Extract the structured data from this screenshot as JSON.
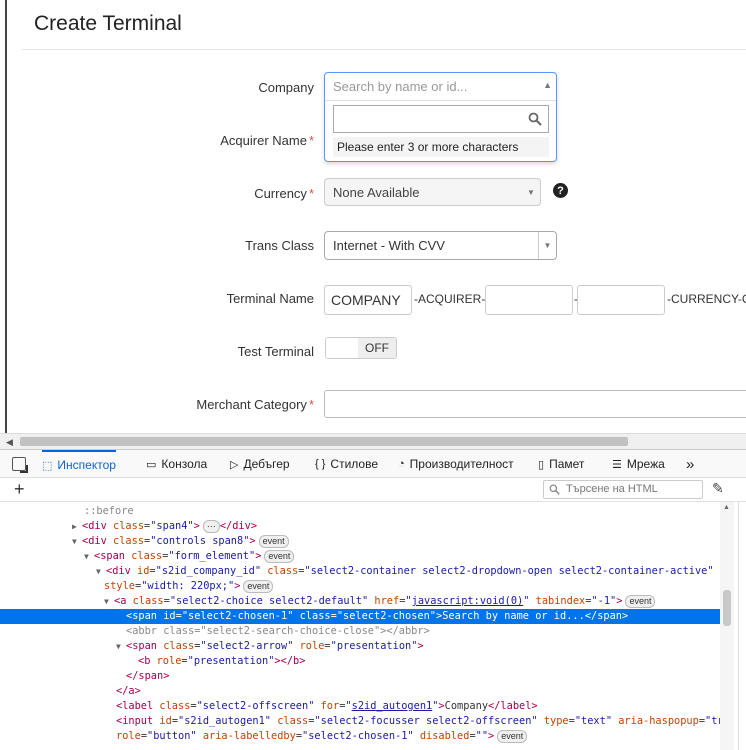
{
  "page": {
    "title": "Create Terminal"
  },
  "form": {
    "company": {
      "label": "Company",
      "placeholder": "Search by name or id...",
      "hint": "Please enter 3 or more characters"
    },
    "acquirer": {
      "label": "Acquirer Name",
      "required": "*"
    },
    "currency": {
      "label": "Currency",
      "required": "*",
      "value": "None Available",
      "help": "?"
    },
    "trans_class": {
      "label": "Trans Class",
      "value": "Internet - With CVV"
    },
    "terminal_name": {
      "label": "Terminal Name",
      "company_value": "COMPANY",
      "sep1": "-ACQUIRER-",
      "sep2": "-",
      "sep3": "-CURRENCY-C"
    },
    "test_terminal": {
      "label": "Test Terminal",
      "value": "OFF"
    },
    "merchant_category": {
      "label": "Merchant Category",
      "required": "*"
    }
  },
  "devtools": {
    "tabs": [
      {
        "label": "Инспектор",
        "icon": "inspector-icon"
      },
      {
        "label": "Конзола",
        "icon": "console-icon"
      },
      {
        "label": "Дебъгер",
        "icon": "debugger-icon"
      },
      {
        "label": "Стилове",
        "icon": "braces-icon"
      },
      {
        "label": "Производителност",
        "icon": "performance-icon"
      },
      {
        "label": "Памет",
        "icon": "memory-icon"
      },
      {
        "label": "Мрежа",
        "icon": "network-icon"
      }
    ],
    "more": "»",
    "search_placeholder": "Търсене на HTML",
    "badges": {
      "event": "event",
      "ellipsis": "⋯"
    }
  },
  "colors": {
    "selected_row": "#0074e8",
    "accent": "#0a64d6",
    "required": "#d9534f",
    "dropdown_border": "#5897fb"
  }
}
